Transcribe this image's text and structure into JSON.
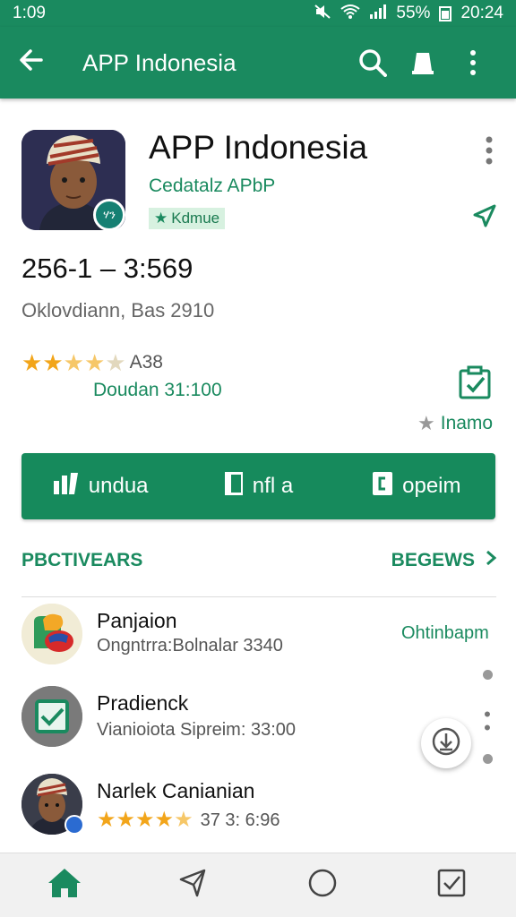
{
  "status_bar": {
    "time_left": "1:09",
    "battery_pct": "55%",
    "time_right": "20:24",
    "icons": [
      "mute-icon",
      "wifi-icon",
      "signal-icon",
      "battery-icon"
    ]
  },
  "appbar": {
    "title": "APP Indonesia",
    "icons": [
      "back-arrow-icon",
      "search-icon",
      "notification-icon",
      "more-vert-icon"
    ]
  },
  "app": {
    "title": "APP Indonesia",
    "subtitle": "Cedatalz APbP",
    "chip_label": "Kdmue",
    "badge_text": "ሃን",
    "price_line": "256-1 – 3:569",
    "developer": "Oklovdiann, Bas 2910",
    "rating_text": "A38",
    "rating_value": 3.5,
    "downloads": "Doudan 31:100",
    "wishlist_label": "Inamo"
  },
  "actions": [
    {
      "label": "undua",
      "icon": "stats-icon"
    },
    {
      "label": "nfl a",
      "icon": "book-icon"
    },
    {
      "label": "opeim",
      "icon": "open-app-icon"
    }
  ],
  "section": {
    "left": "PBCTIVEARS",
    "right": "BEGEWS"
  },
  "list": [
    {
      "title": "Panjaion",
      "subtitle": "Ongntrra:Bolnalar 3340",
      "link": "Ohtinbapm"
    },
    {
      "title": "Pradienck",
      "subtitle": "Vianioiota Sipreim: 33:00"
    },
    {
      "title": "Narlek Canianian",
      "rating_value": 4.5,
      "rating_text": "37 3: 6:96"
    }
  ],
  "colors": {
    "primary": "#1a8a5f",
    "star": "#f2a51a",
    "chip_bg": "#d7f1e0"
  }
}
